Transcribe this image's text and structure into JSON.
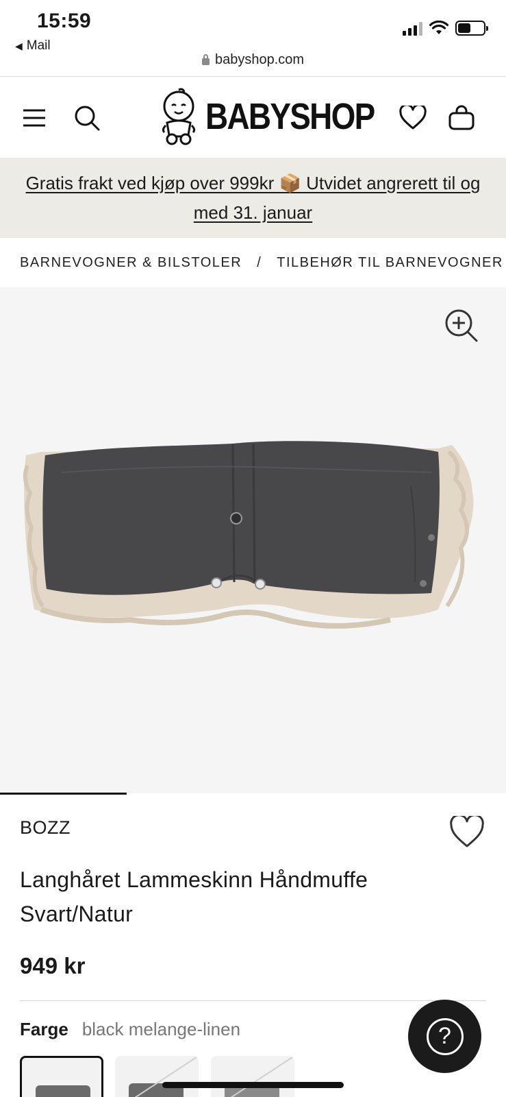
{
  "status_bar": {
    "time": "15:59",
    "back_app": "Mail",
    "url": "babyshop.com"
  },
  "header": {
    "logo_text": "BABYSHOP",
    "icons": [
      "menu-icon",
      "search-icon",
      "heart-icon",
      "bag-icon"
    ]
  },
  "promo": {
    "text": "Gratis frakt ved kjøp over 999kr 📦 Utvidet angrerett til og med 31. januar"
  },
  "breadcrumb": {
    "items": [
      "BARNEVOGNER & BILSTOLER",
      "TILBEHØR TIL BARNEVOGNER"
    ],
    "separator": "/"
  },
  "product": {
    "brand": "BOZZ",
    "title": "Langhåret Lammeskinn Håndmuffe Svart/Natur",
    "price": "949 kr",
    "color_label": "Farge",
    "color_value": "black melange-linen"
  },
  "help": {
    "icon_glyph": "?"
  },
  "colors": {
    "promo_bg": "#ecebe6",
    "image_bg": "#f5f5f5",
    "help_bg": "#1b1b1b"
  }
}
